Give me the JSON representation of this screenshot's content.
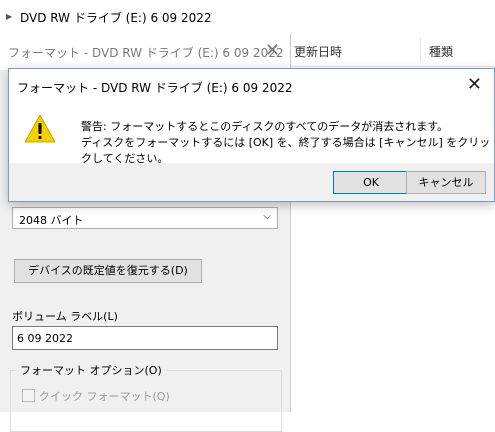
{
  "explorer": {
    "title": "DVD RW ドライブ (E:) 6 09 2022",
    "columns": [
      "更新日時",
      "種類"
    ]
  },
  "format_dialog": {
    "title": "フォーマット - DVD RW ドライブ (E:) 6 09 2022",
    "close_glyph": "✕",
    "allocation_value": "2048 バイト",
    "restore_button": "デバイスの既定値を復元する(D)",
    "volume_label_caption": "ボリューム ラベル(L)",
    "volume_label_value": "6 09 2022",
    "options_group": "フォーマット オプション(O)",
    "quick_format": "クイック フォーマット(Q)"
  },
  "message_box": {
    "title": "フォーマット - DVD RW ドライブ (E:) 6 09 2022",
    "close_glyph": "✕",
    "line1": "警告: フォーマットするとこのディスクのすべてのデータが消去されます。",
    "line2": "ディスクをフォーマットするには [OK] を、終了する場合は [キャンセル] をクリックしてください。",
    "ok_button": "OK",
    "cancel_button": "キャンセル",
    "icon": "warning-icon",
    "icon_color": "#f5d000"
  }
}
